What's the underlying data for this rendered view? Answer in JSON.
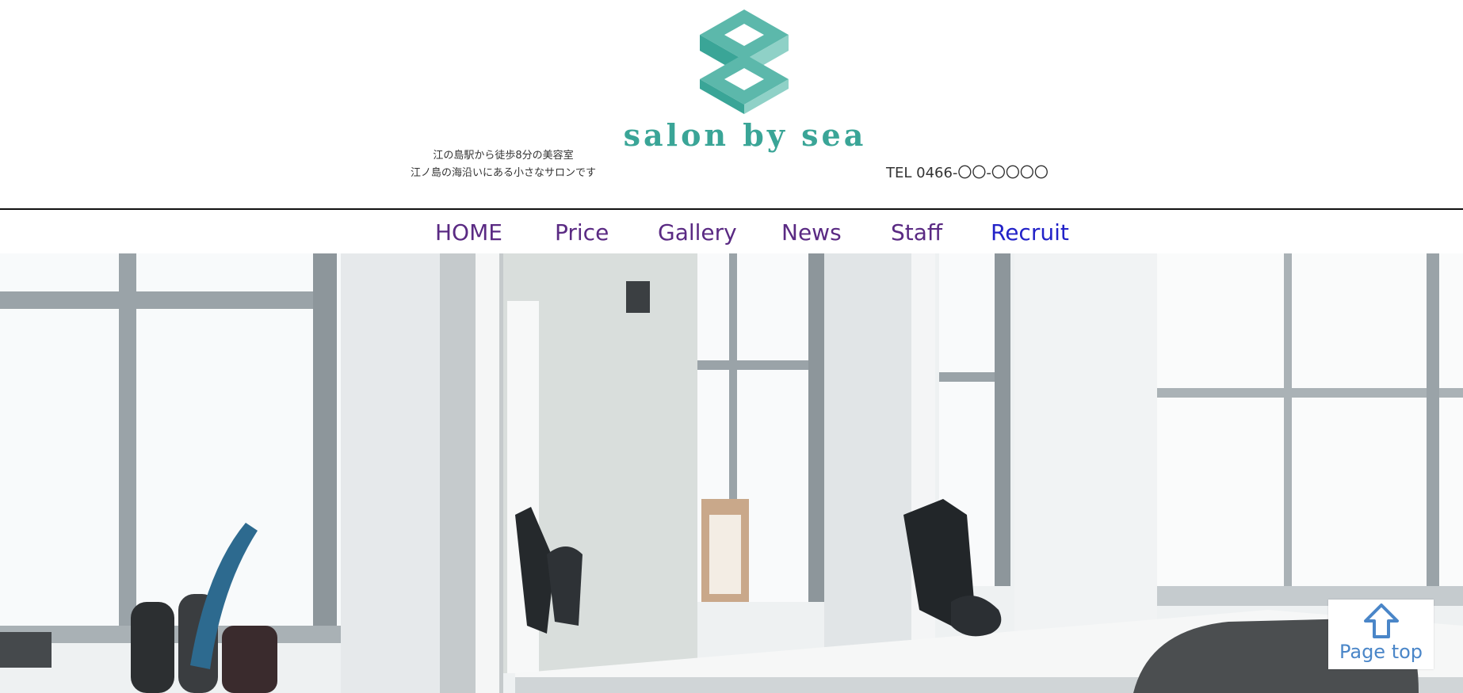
{
  "brand": {
    "name": "salon by sea",
    "accent_color": "#3aa597",
    "logo_icon": "interlocking-squares-logo"
  },
  "header": {
    "tagline_line1": "江の島駅から徒歩8分の美容室",
    "tagline_line2": "江ノ島の海沿いにある小さなサロンです",
    "tel": "TEL 0466-〇〇-〇〇〇〇"
  },
  "nav": {
    "items": [
      {
        "label": "HOME"
      },
      {
        "label": "Price"
      },
      {
        "label": "Gallery"
      },
      {
        "label": "News"
      },
      {
        "label": "Staff"
      },
      {
        "label": "Recruit"
      }
    ],
    "visited_color": "#5a2a83",
    "link_color": "#2222c8"
  },
  "hero": {
    "icon": "salon-interior-photo"
  },
  "pagetop": {
    "label": "Page top",
    "icon": "arrow-up-icon",
    "color": "#4a86c8"
  }
}
